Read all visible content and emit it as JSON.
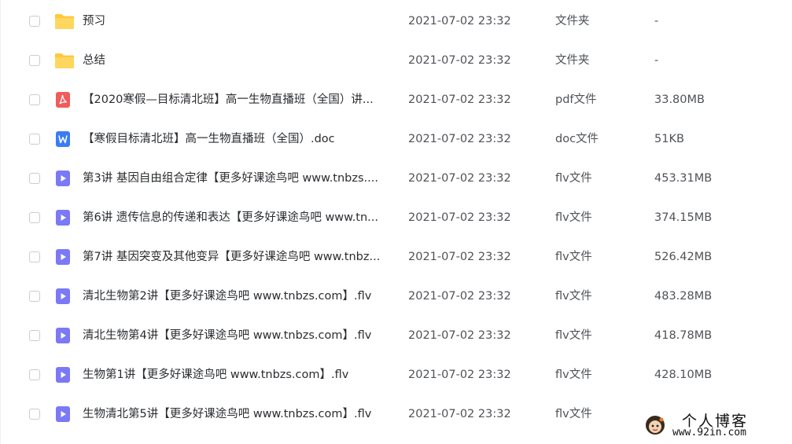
{
  "files": [
    {
      "name": "预习",
      "date": "2021-07-02 23:32",
      "type": "文件夹",
      "size": "-",
      "icon": "folder-icon"
    },
    {
      "name": "总结",
      "date": "2021-07-02 23:32",
      "type": "文件夹",
      "size": "-",
      "icon": "folder-icon"
    },
    {
      "name": "【2020寒假—目标清北班】高一生物直播班（全国）讲...",
      "date": "2021-07-02 23:32",
      "type": "pdf文件",
      "size": "33.80MB",
      "icon": "pdf-icon"
    },
    {
      "name": "【寒假目标清北班】高一生物直播班（全国）.doc",
      "date": "2021-07-02 23:32",
      "type": "doc文件",
      "size": "51KB",
      "icon": "word-doc-icon"
    },
    {
      "name": "第3讲 基因自由组合定律【更多好课途鸟吧 www.tnbzs....",
      "date": "2021-07-02 23:32",
      "type": "flv文件",
      "size": "453.31MB",
      "icon": "video-file-icon"
    },
    {
      "name": "第6讲 遗传信息的传递和表达【更多好课途鸟吧 www.tn...",
      "date": "2021-07-02 23:32",
      "type": "flv文件",
      "size": "374.15MB",
      "icon": "video-file-icon"
    },
    {
      "name": "第7讲 基因突变及其他变异【更多好课途鸟吧 www.tnbz...",
      "date": "2021-07-02 23:32",
      "type": "flv文件",
      "size": "526.42MB",
      "icon": "video-file-icon"
    },
    {
      "name": "清北生物第2讲【更多好课途鸟吧 www.tnbzs.com】.flv",
      "date": "2021-07-02 23:32",
      "type": "flv文件",
      "size": "483.28MB",
      "icon": "video-file-icon"
    },
    {
      "name": "清北生物第4讲【更多好课途鸟吧 www.tnbzs.com】.flv",
      "date": "2021-07-02 23:32",
      "type": "flv文件",
      "size": "418.78MB",
      "icon": "video-file-icon"
    },
    {
      "name": "生物第1讲【更多好课途鸟吧 www.tnbzs.com】.flv",
      "date": "2021-07-02 23:32",
      "type": "flv文件",
      "size": "428.10MB",
      "icon": "video-file-icon"
    },
    {
      "name": "生物清北第5讲【更多好课途鸟吧 www.tnbzs.com】.flv",
      "date": "2021-07-02 23:32",
      "type": "flv文件",
      "size": "",
      "icon": "video-file-icon"
    }
  ],
  "watermark": {
    "title": "个人博客",
    "url": "www.92in.com"
  },
  "colors": {
    "folder": "#ffc83d",
    "pdf": "#f25b5b",
    "doc": "#3b7cf5",
    "video": "#7b79f5"
  }
}
